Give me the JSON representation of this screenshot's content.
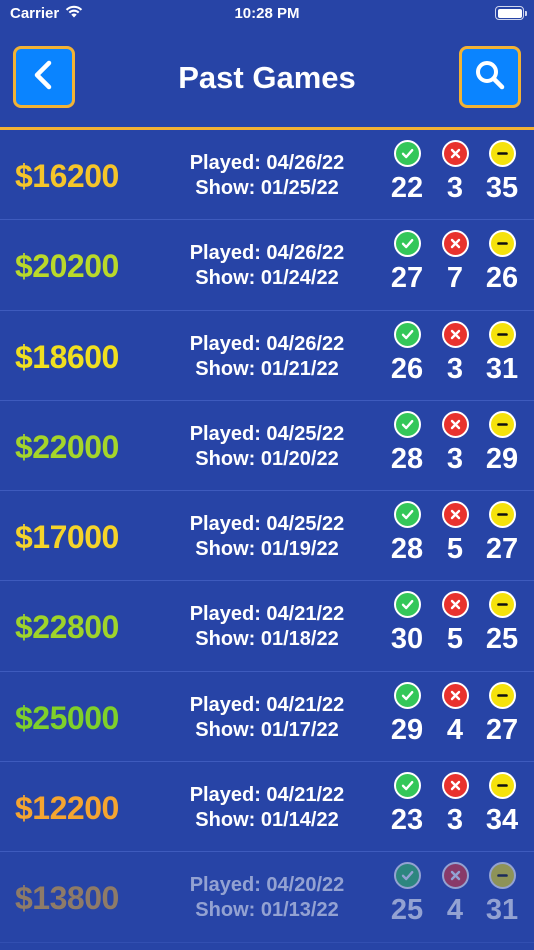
{
  "status_bar": {
    "carrier": "Carrier",
    "time": "10:28 PM"
  },
  "header": {
    "title": "Past Games"
  },
  "games": [
    {
      "amount": "$16200",
      "amount_color": "#f5c52a",
      "played": "Played: 04/26/22",
      "show": "Show: 01/25/22",
      "correct": "22",
      "wrong": "3",
      "skipped": "35"
    },
    {
      "amount": "$20200",
      "amount_color": "#b9d92a",
      "played": "Played: 04/26/22",
      "show": "Show: 01/24/22",
      "correct": "27",
      "wrong": "7",
      "skipped": "26"
    },
    {
      "amount": "$18600",
      "amount_color": "#f0e020",
      "played": "Played: 04/26/22",
      "show": "Show: 01/21/22",
      "correct": "26",
      "wrong": "3",
      "skipped": "31"
    },
    {
      "amount": "$22000",
      "amount_color": "#a5d52a",
      "played": "Played: 04/25/22",
      "show": "Show: 01/20/22",
      "correct": "28",
      "wrong": "3",
      "skipped": "29"
    },
    {
      "amount": "$17000",
      "amount_color": "#f5d42a",
      "played": "Played: 04/25/22",
      "show": "Show: 01/19/22",
      "correct": "28",
      "wrong": "5",
      "skipped": "27"
    },
    {
      "amount": "$22800",
      "amount_color": "#9fd42a",
      "played": "Played: 04/21/22",
      "show": "Show: 01/18/22",
      "correct": "30",
      "wrong": "5",
      "skipped": "25"
    },
    {
      "amount": "$25000",
      "amount_color": "#7fd02a",
      "played": "Played: 04/21/22",
      "show": "Show: 01/17/22",
      "correct": "29",
      "wrong": "4",
      "skipped": "27"
    },
    {
      "amount": "$12200",
      "amount_color": "#f5a530",
      "played": "Played: 04/21/22",
      "show": "Show: 01/14/22",
      "correct": "23",
      "wrong": "3",
      "skipped": "34"
    },
    {
      "amount": "$13800",
      "amount_color": "#f5b32c",
      "played": "Played: 04/20/22",
      "show": "Show: 01/13/22",
      "correct": "25",
      "wrong": "4",
      "skipped": "31"
    }
  ]
}
